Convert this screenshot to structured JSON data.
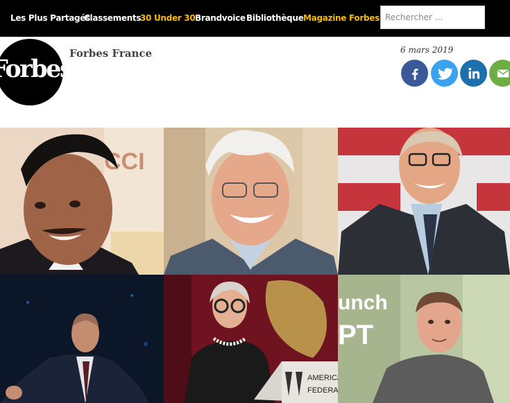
{
  "nav": {
    "items": [
      {
        "label": "Les Plus Partagés"
      },
      {
        "label": "Classements"
      },
      {
        "label": "30 Under 30"
      },
      {
        "label": "Brandvoice"
      },
      {
        "label": "Bibliothèque"
      },
      {
        "label": "Magazine Forbes"
      }
    ],
    "highlight_color": "#f7b800",
    "search_placeholder": "Rechercher ..."
  },
  "header": {
    "logo_text": "Forbes",
    "author": "Forbes France",
    "date": "6 mars 2019"
  },
  "share": {
    "buttons": [
      {
        "icon": "facebook-icon",
        "color": "#3b5998"
      },
      {
        "icon": "twitter-icon",
        "color": "#3ba3ee"
      },
      {
        "icon": "linkedin-icon",
        "color": "#1e6fae"
      },
      {
        "icon": "email-icon",
        "color": "#6cae43"
      }
    ]
  },
  "photo": {
    "sign_text_top": "CCI",
    "lectern_text_line1": "AMERICA",
    "lectern_text_line2": "FEDERAT",
    "backdrop_text_line1": "unch",
    "backdrop_text_line2": "PT"
  }
}
